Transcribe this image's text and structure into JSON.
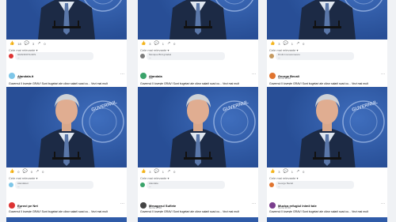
{
  "post_text": "Guvernul îl lovește GRAV! Sunt bugetari ale căror salarii scad cu... Vezi mai mult",
  "relevant_label": "Cele mai relevante",
  "logo_text": "GUVERNUL ROMÂNIEI",
  "columns": [
    {
      "row1": {
        "likes": "18",
        "comments": "3",
        "shares": "0",
        "reply_author": "GRANDOTA IRIS",
        "reply_text": "..."
      },
      "row2": {
        "author": "Alandala.it",
        "time": "15h",
        "likes": "0",
        "comments": "0",
        "shares": "0",
        "reply_author": "Alandala.it",
        "reply_text": "..."
      },
      "row3": {
        "author": "Eurovi pe Net",
        "time": "22h"
      }
    },
    {
      "row1": {
        "likes": "3",
        "comments": "1",
        "shares": "0",
        "reply_author": "Monique Bird giradiel",
        "reply_text": "..."
      },
      "row2": {
        "author": "Alandala",
        "time": "15h",
        "likes": "3",
        "comments": "1",
        "shares": "0",
        "reply_author": "Alandala",
        "reply_text": "..."
      },
      "row3": {
        "author": "Mesagerul Suflete",
        "time": "Noi la 16:30"
      }
    },
    {
      "row1": {
        "likes": "3",
        "comments": "1",
        "shares": "0",
        "reply_author": "Drulini na iacomescu",
        "reply_text": "..."
      },
      "row2": {
        "author": "George Becali",
        "time": "Noi la 16:30",
        "likes": "3",
        "comments": "1",
        "shares": "0",
        "reply_author": "George Becali",
        "reply_text": "..."
      },
      "row3": {
        "author": "Muzica refugiul inimii tale",
        "time": "Noi la 16:30"
      }
    }
  ],
  "colors": {
    "fb_blue": "#1877f2",
    "guvern_blue": "#2a57a6"
  }
}
